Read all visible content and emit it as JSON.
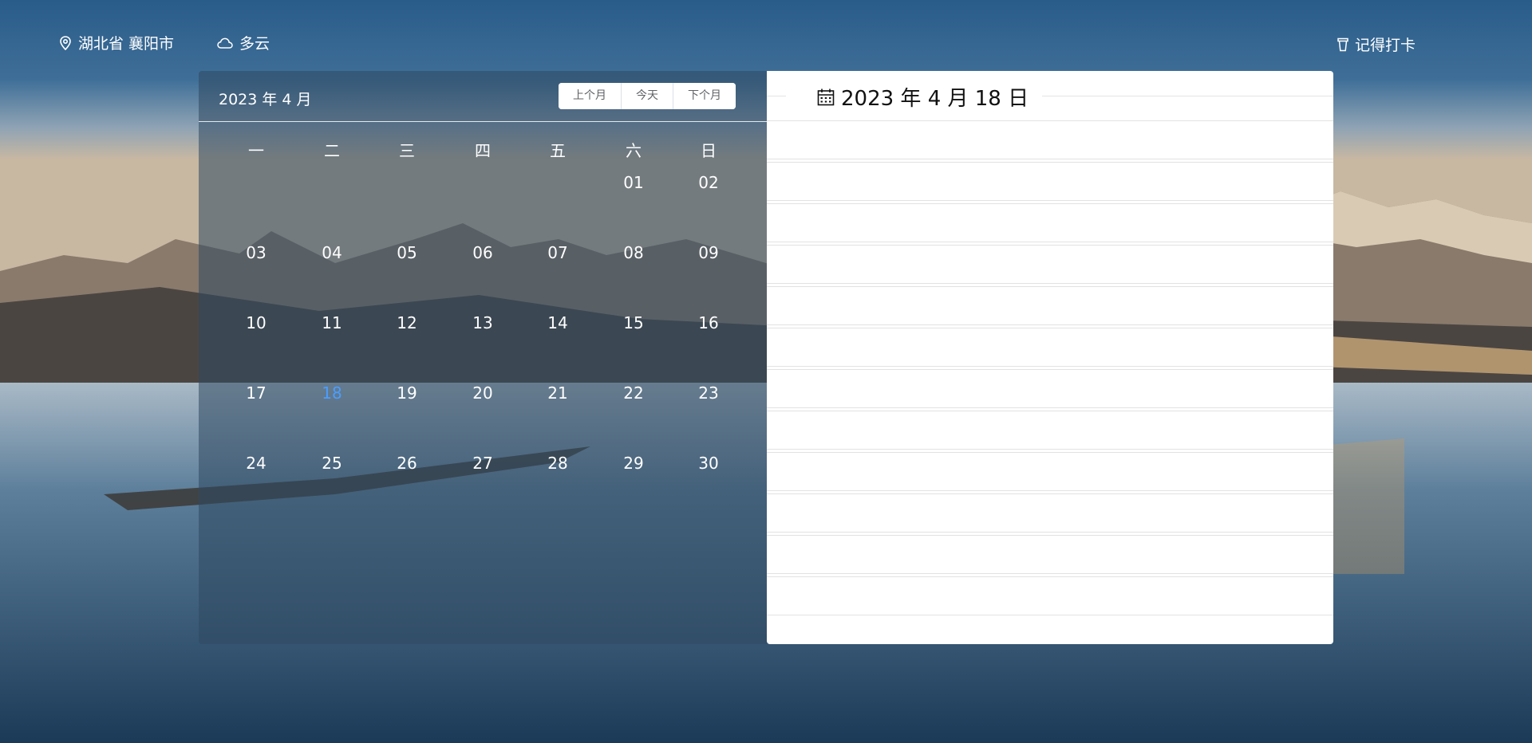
{
  "header": {
    "location": "湖北省 襄阳市",
    "weather": "多云",
    "checkin_label": "记得打卡"
  },
  "calendar": {
    "title": "2023 年 4 月",
    "buttons": {
      "prev": "上个月",
      "today": "今天",
      "next": "下个月"
    },
    "weekdays": [
      "一",
      "二",
      "三",
      "四",
      "五",
      "六",
      "日"
    ],
    "weeks": [
      [
        "",
        "",
        "",
        "",
        "",
        "01",
        "02"
      ],
      [
        "03",
        "04",
        "05",
        "06",
        "07",
        "08",
        "09"
      ],
      [
        "10",
        "11",
        "12",
        "13",
        "14",
        "15",
        "16"
      ],
      [
        "17",
        "18",
        "19",
        "20",
        "21",
        "22",
        "23"
      ],
      [
        "24",
        "25",
        "26",
        "27",
        "28",
        "29",
        "30"
      ]
    ],
    "selected_day": "18",
    "highlight_color": "#4a9eff"
  },
  "detail": {
    "date_title": "2023 年 4 月 18 日",
    "rows": [
      "",
      "",
      "",
      "",
      "",
      "",
      "",
      "",
      "",
      "",
      "",
      ""
    ]
  },
  "icons": {
    "location": "map-pin-icon",
    "weather": "cloud-icon",
    "checkin": "cup-icon",
    "date": "calendar-icon"
  }
}
